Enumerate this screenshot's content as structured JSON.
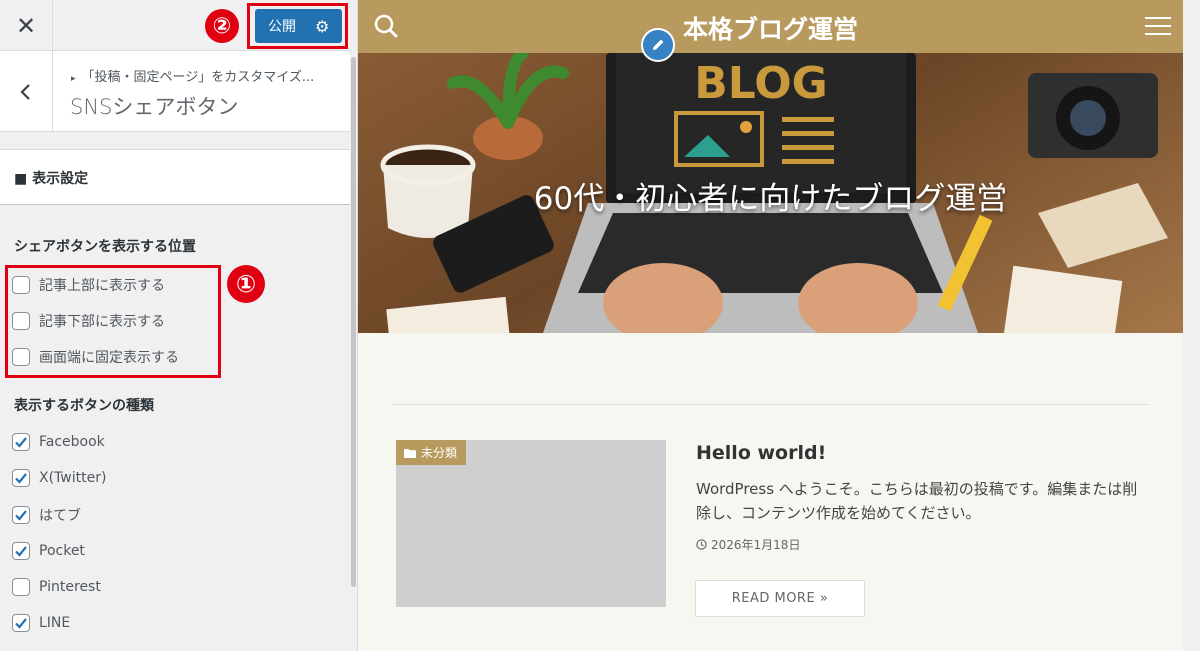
{
  "customizer": {
    "close_icon": "close-icon",
    "publish_label": "公開",
    "publish_gear_icon": "gear-icon",
    "marker_2": "②",
    "marker_1": "①",
    "breadcrumb": "「投稿・固定ページ」をカスタマイズ...",
    "section_title": "SNSシェアボタン",
    "group_title": "■ 表示設定",
    "position": {
      "label": "シェアボタンを表示する位置",
      "options": [
        {
          "label": "記事上部に表示する",
          "checked": false
        },
        {
          "label": "記事下部に表示する",
          "checked": false
        },
        {
          "label": "画面端に固定表示する",
          "checked": false
        }
      ]
    },
    "buttons": {
      "label": "表示するボタンの種類",
      "options": [
        {
          "label": "Facebook",
          "checked": true
        },
        {
          "label": "X(Twitter)",
          "checked": true
        },
        {
          "label": "はてブ",
          "checked": true
        },
        {
          "label": "Pocket",
          "checked": true
        },
        {
          "label": "Pinterest",
          "checked": false
        },
        {
          "label": "LINE",
          "checked": true
        }
      ]
    },
    "accent_color": "#2271b1",
    "highlight_color": "#e00012"
  },
  "site": {
    "title": "本格ブログ運営",
    "header_color": "#b89a5f",
    "hero_caption": "60代・初心者に向けたブログ運営",
    "post": {
      "category": "未分類",
      "title": "Hello world!",
      "excerpt": "WordPress へようこそ。こちらは最初の投稿です。編集または削除し、コンテンツ作成を始めてください。",
      "date": "2026年1月18日",
      "read_more": "READ MORE »"
    }
  }
}
